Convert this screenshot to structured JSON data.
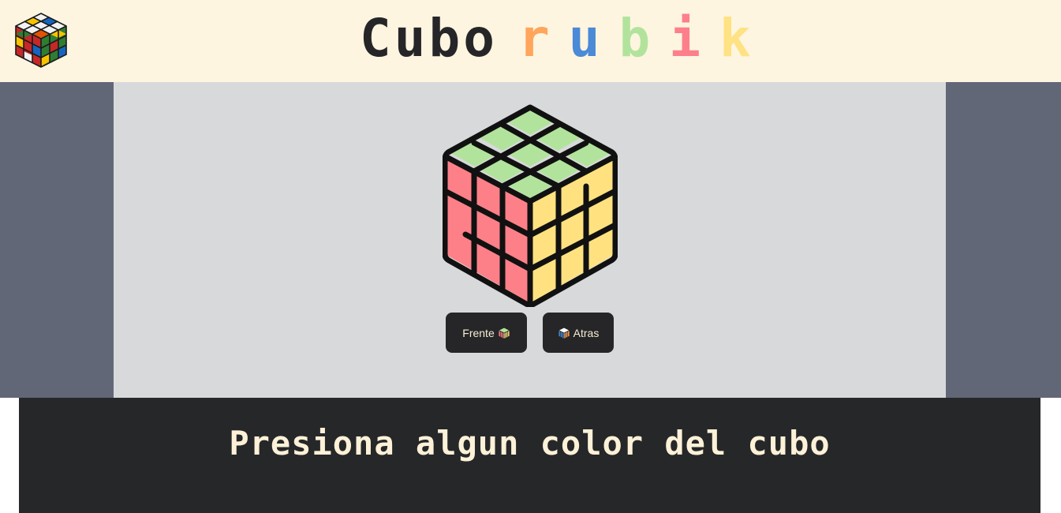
{
  "header": {
    "title_word": "Cubo",
    "title_letters": [
      {
        "char": "r",
        "color": "#ffa55c"
      },
      {
        "char": "u",
        "color": "#4a8ad6"
      },
      {
        "char": "b",
        "color": "#b2e39c"
      },
      {
        "char": "i",
        "color": "#fd7f8b"
      },
      {
        "char": "k",
        "color": "#fee283"
      }
    ],
    "logo_icon": "rubik-cube-logo-icon"
  },
  "cube": {
    "icon": "rubik-cube-icon",
    "colors": {
      "top": "#b2e39c",
      "left": "#fd8088",
      "right": "#ffe27f",
      "outline": "#111111"
    }
  },
  "buttons": {
    "front_label": "Frente",
    "back_label": "Atras"
  },
  "footer": {
    "message": "Presiona algun color del cubo"
  },
  "colors": {
    "header_bg": "#fdf5e0",
    "band_bg": "#626778",
    "stage_bg": "#d8d9db",
    "dark": "#262628",
    "cream_text": "#fdf1d8"
  }
}
